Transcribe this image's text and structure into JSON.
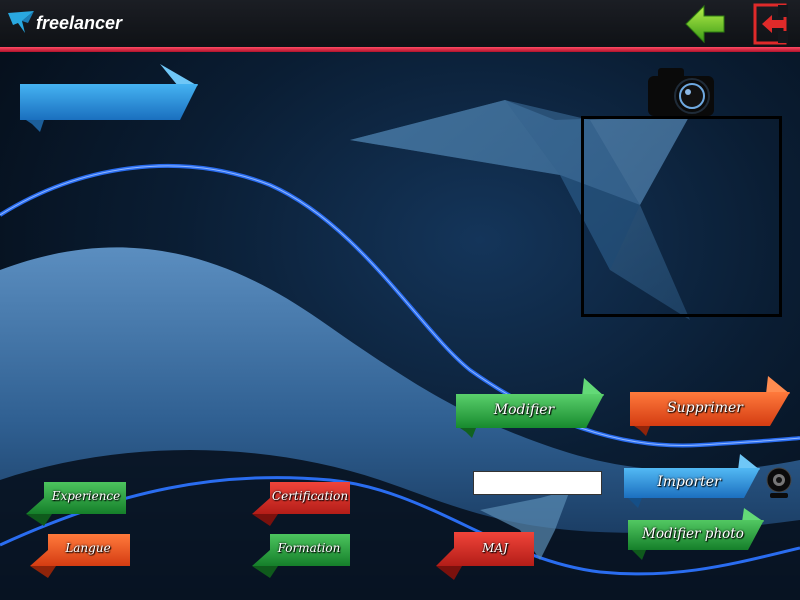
{
  "app": {
    "logo_text": "freelancer",
    "colors": {
      "accent": "#e0213f",
      "blue": "#2a95e0",
      "green": "#27a045",
      "red": "#e1352c",
      "orange": "#ef5a22",
      "topbar": "#14171c"
    }
  },
  "header": {
    "back_icon": "green-back-arrow-icon",
    "logout_icon": "red-exit-door-icon"
  },
  "photo": {
    "camera_icon": "camera-icon",
    "webcam_icon": "webcam-icon",
    "path_value": ""
  },
  "buttons": {
    "modifier": "Modifier",
    "supprimer": "Supprimer",
    "importer": "Importer",
    "modifier_photo": "Modifier photo",
    "experience": "Experience",
    "certification": "Certification",
    "langue": "Langue",
    "formation": "Formation",
    "maj": "MAJ"
  }
}
